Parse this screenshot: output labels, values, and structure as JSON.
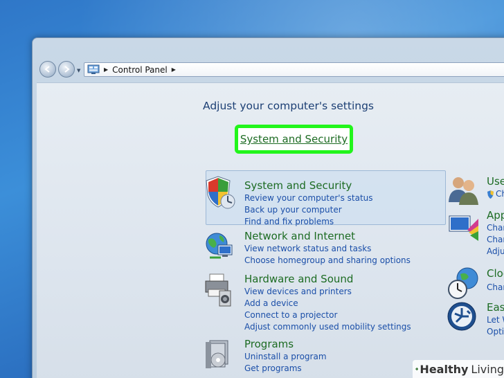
{
  "window": {
    "breadcrumb": "Control Panel",
    "heading": "Adjust your computer's settings"
  },
  "categories_left": [
    {
      "title": "System and Security",
      "links": [
        "Review your computer's status",
        "Back up your computer",
        "Find and fix problems"
      ],
      "icon": "shield-icon"
    },
    {
      "title": "Network and Internet",
      "links": [
        "View network status and tasks",
        "Choose homegroup and sharing options"
      ],
      "icon": "network-globe-icon"
    },
    {
      "title": "Hardware and Sound",
      "links": [
        "View devices and printers",
        "Add a device",
        "Connect to a projector",
        "Adjust commonly used mobility settings"
      ],
      "icon": "printer-icon"
    },
    {
      "title": "Programs",
      "links": [
        "Uninstall a program",
        "Get programs"
      ],
      "icon": "programs-icon"
    }
  ],
  "categories_right": [
    {
      "title": "User",
      "links": [
        "Ch"
      ],
      "icon": "users-icon"
    },
    {
      "title": "App",
      "links": [
        "Chan",
        "Chan",
        "Adjus"
      ],
      "icon": "appearance-icon"
    },
    {
      "title": "Cloc",
      "links": [
        "Chan"
      ],
      "icon": "clock-globe-icon"
    },
    {
      "title": "Ease",
      "links": [
        "Let W",
        "Optin"
      ],
      "icon": "ease-of-access-icon"
    }
  ],
  "highlight_label": "System and Security",
  "watermark": {
    "brand": "Healthy",
    "brand2": "Living"
  },
  "colors": {
    "category_title": "#1c6b22",
    "link": "#1a4ea8",
    "heading": "#1c3f74",
    "highlight_border": "#22f51b"
  }
}
